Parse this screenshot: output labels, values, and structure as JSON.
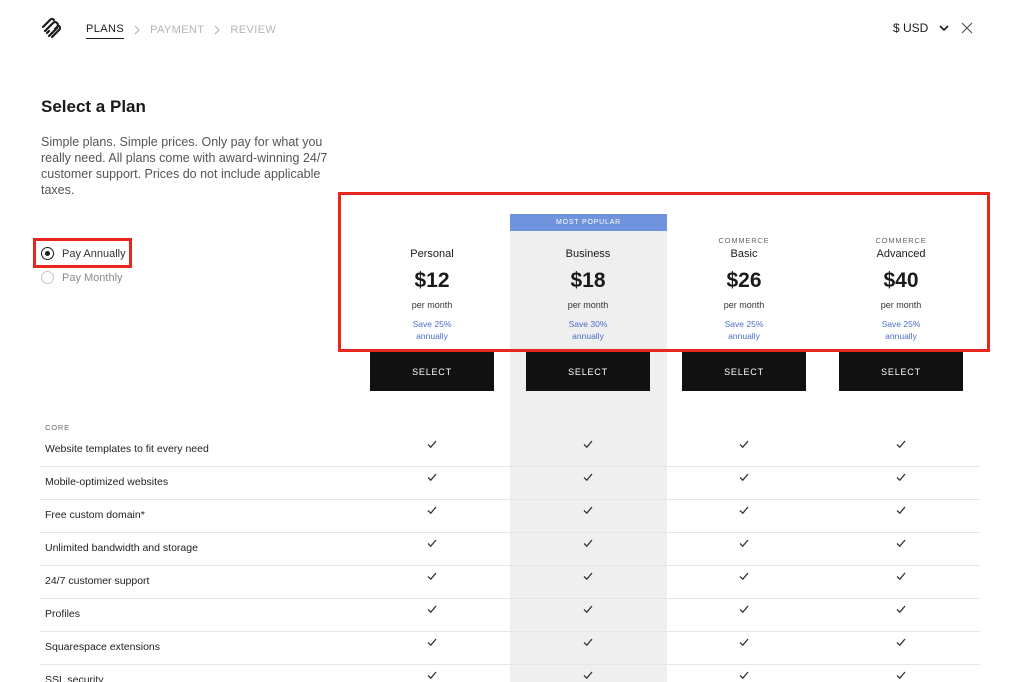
{
  "header": {
    "steps": [
      {
        "label": "PLANS",
        "active": true
      },
      {
        "label": "PAYMENT",
        "active": false
      },
      {
        "label": "REVIEW",
        "active": false
      }
    ],
    "currency": "$ USD"
  },
  "intro": {
    "title": "Select a Plan",
    "description": "Simple plans. Simple prices. Only pay for what you really need. All plans come with award-winning 24/7 customer support. Prices do not include applicable taxes."
  },
  "billing": {
    "options": [
      {
        "label": "Pay Annually",
        "selected": true
      },
      {
        "label": "Pay Monthly",
        "selected": false
      }
    ]
  },
  "popular_badge": "MOST POPULAR",
  "plans": [
    {
      "tier": "",
      "name": "Personal",
      "price": "$12",
      "period": "per month",
      "save_line1": "Save 25%",
      "save_line2": "annually",
      "button": "SELECT"
    },
    {
      "tier": "",
      "name": "Business",
      "price": "$18",
      "period": "per month",
      "save_line1": "Save 30%",
      "save_line2": "annually",
      "button": "SELECT"
    },
    {
      "tier": "COMMERCE",
      "name": "Basic",
      "price": "$26",
      "period": "per month",
      "save_line1": "Save 25%",
      "save_line2": "annually",
      "button": "SELECT"
    },
    {
      "tier": "COMMERCE",
      "name": "Advanced",
      "price": "$40",
      "period": "per month",
      "save_line1": "Save 25%",
      "save_line2": "annually",
      "button": "SELECT"
    }
  ],
  "features": {
    "section_label": "CORE",
    "rows": [
      {
        "name": "Website templates to fit every need",
        "included": [
          true,
          true,
          true,
          true
        ]
      },
      {
        "name": "Mobile-optimized websites",
        "included": [
          true,
          true,
          true,
          true
        ]
      },
      {
        "name": "Free custom domain*",
        "included": [
          true,
          true,
          true,
          true
        ]
      },
      {
        "name": "Unlimited bandwidth and storage",
        "included": [
          true,
          true,
          true,
          true
        ]
      },
      {
        "name": "24/7 customer support",
        "included": [
          true,
          true,
          true,
          true
        ]
      },
      {
        "name": "Profiles",
        "included": [
          true,
          true,
          true,
          true
        ]
      },
      {
        "name": "Squarespace extensions",
        "included": [
          true,
          true,
          true,
          true
        ]
      },
      {
        "name": "SSL security",
        "included": [
          true,
          true,
          true,
          true
        ]
      }
    ]
  },
  "icons": {
    "logo": "squarespace-logo-icon",
    "step_separator": "chevron-right-icon",
    "currency_toggle": "chevron-down-icon",
    "close": "close-icon",
    "included": "checkmark-icon"
  },
  "colors": {
    "accent": "#6f93dc",
    "save_text": "#4c6fc7",
    "button": "#111111",
    "highlight_column": "#efefef",
    "annotation": "#e8261c"
  }
}
